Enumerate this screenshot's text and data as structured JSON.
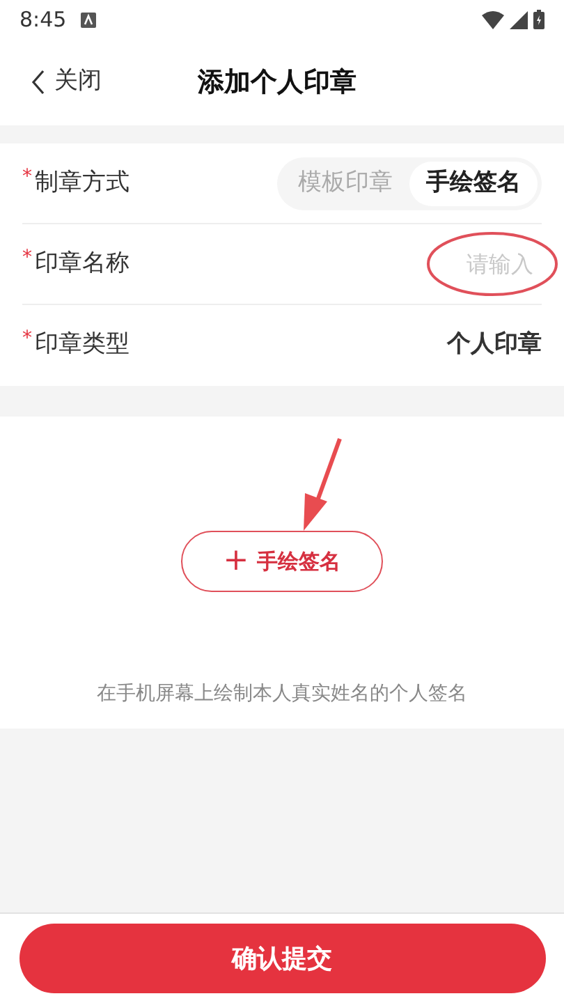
{
  "status_bar": {
    "time": "8:45"
  },
  "header": {
    "back_label": "关闭",
    "title": "添加个人印章"
  },
  "form": {
    "rows": [
      {
        "kind": "segmented",
        "label": "制章方式",
        "required_mark": "*",
        "options": [
          {
            "label": "模板印章",
            "selected": false
          },
          {
            "label": "手绘签名",
            "selected": true
          }
        ]
      },
      {
        "kind": "input",
        "label": "印章名称",
        "required_mark": "*",
        "placeholder": "请输入"
      },
      {
        "kind": "value",
        "label": "印章类型",
        "required_mark": "*",
        "value": "个人印章"
      }
    ]
  },
  "signature": {
    "button_icon": "+",
    "button_label": "手绘签名",
    "hint": "在手机屏幕上绘制本人真实姓名的个人签名"
  },
  "submit_button": "确认提交"
}
